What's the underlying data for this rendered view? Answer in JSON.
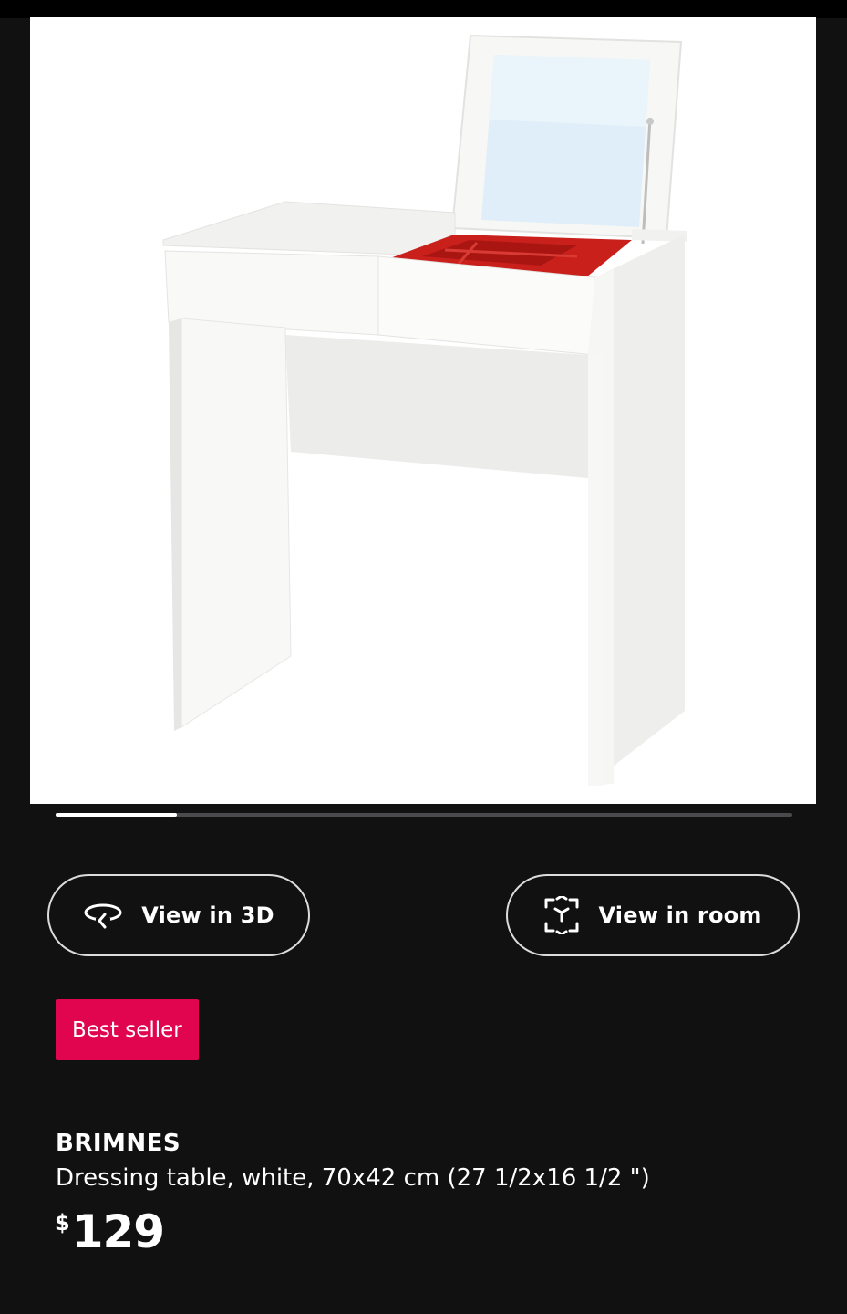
{
  "gallery": {
    "image_alt": "BRIMNES dressing table with open mirror lid",
    "progress": 0.165
  },
  "actions": {
    "view_3d_label": "View in 3D",
    "view_3d_icon": "rotate-3d-icon",
    "view_room_label": "View in room",
    "view_room_icon": "ar-cube-icon"
  },
  "badge": {
    "label": "Best seller",
    "color": "#e0054e"
  },
  "product": {
    "name": "BRIMNES",
    "description": "Dressing table, white, 70x42 cm (27 1/2x16 1/2 \")",
    "price_currency": "$",
    "price_amount": "129"
  }
}
